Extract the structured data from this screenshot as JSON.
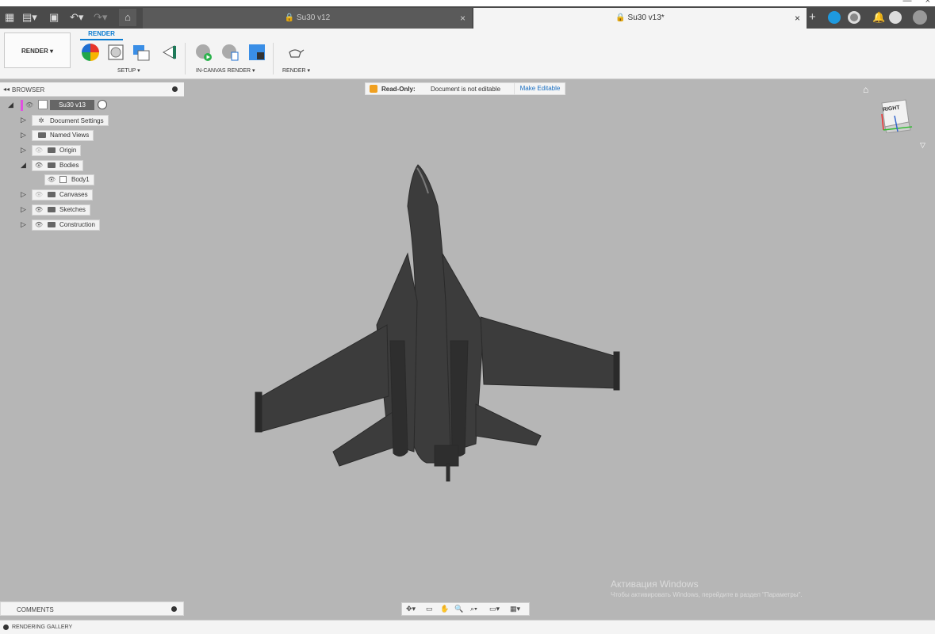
{
  "window": {
    "minimize": "—",
    "close": "×"
  },
  "tabs": [
    {
      "label": "Su30 v12",
      "active": false
    },
    {
      "label": "Su30 v13*",
      "active": true
    }
  ],
  "ribbon": {
    "workspace": "RENDER",
    "tab": "RENDER",
    "groups": [
      "SETUP",
      "IN-CANVAS RENDER",
      "RENDER"
    ]
  },
  "browser": {
    "title": "BROWSER",
    "root": "Su30 v13",
    "items": [
      {
        "label": "Document Settings"
      },
      {
        "label": "Named Views"
      },
      {
        "label": "Origin"
      },
      {
        "label": "Bodies"
      },
      {
        "label": "Body1"
      },
      {
        "label": "Canvases"
      },
      {
        "label": "Sketches"
      },
      {
        "label": "Construction"
      }
    ]
  },
  "banner": {
    "title": "Read-Only:",
    "message": "Document is not editable",
    "action": "Make Editable"
  },
  "viewcube": {
    "face": "RIGHT"
  },
  "comments": {
    "label": "COMMENTS"
  },
  "status": {
    "label": "RENDERING GALLERY"
  },
  "watermark": {
    "title": "Активация Windows",
    "subtitle": "Чтобы активировать Windows, перейдите в раздел \"Параметры\"."
  },
  "colors": {
    "accent": "#0a7bd0",
    "canvas": "#b6b6b6",
    "warning": "#f0a020"
  }
}
